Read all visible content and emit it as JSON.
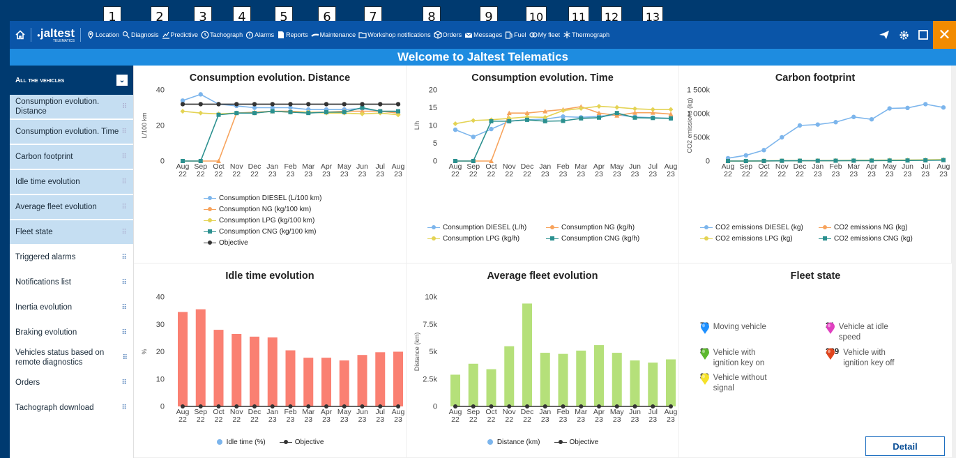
{
  "callouts": [
    "1",
    "2",
    "3",
    "4",
    "5",
    "6",
    "7",
    "8",
    "9",
    "10",
    "11",
    "12",
    "13"
  ],
  "brand": {
    "logo": "jaltest",
    "logo_sub": "TELEMATICS"
  },
  "nav": [
    {
      "label": "Location",
      "icon": "location-pin-icon"
    },
    {
      "label": "Diagnosis",
      "icon": "diagnosis-icon"
    },
    {
      "label": "Predictive",
      "icon": "predictive-icon"
    },
    {
      "label": "Tachograph",
      "icon": "tachograph-icon"
    },
    {
      "label": "Alarms",
      "icon": "alarm-icon"
    },
    {
      "label": "Reports",
      "icon": "reports-icon"
    },
    {
      "label": "Maintenance",
      "icon": "wrench-icon"
    },
    {
      "label": "Workshop notifications",
      "icon": "folder-icon"
    },
    {
      "label": "Orders",
      "icon": "box-icon"
    },
    {
      "label": "Messages",
      "icon": "envelope-icon"
    },
    {
      "label": "Fuel",
      "icon": "fuel-pump-icon"
    },
    {
      "label": "My fleet",
      "icon": "fleet-icon"
    },
    {
      "label": "Thermograph",
      "icon": "snowflake-icon"
    }
  ],
  "welcome": "Welcome to Jaltest Telematics",
  "sidebar": {
    "header": "All the vehicles",
    "items": [
      {
        "label": "Consumption evolution. Distance",
        "active": true
      },
      {
        "label": "Consumption evolution. Time",
        "active": true
      },
      {
        "label": "Carbon footprint",
        "active": true
      },
      {
        "label": "Idle time evolution",
        "active": true
      },
      {
        "label": "Average fleet evolution",
        "active": true
      },
      {
        "label": "Fleet state",
        "active": true
      },
      {
        "label": "Triggered alarms",
        "active": false
      },
      {
        "label": "Notifications list",
        "active": false
      },
      {
        "label": "Inertia evolution",
        "active": false
      },
      {
        "label": "Braking evolution",
        "active": false
      },
      {
        "label": "Vehicles status based on remote diagnostics",
        "active": false
      },
      {
        "label": "Orders",
        "active": false
      },
      {
        "label": "Tachograph download",
        "active": false
      }
    ]
  },
  "months": [
    [
      "Aug",
      "22"
    ],
    [
      "Sep",
      "22"
    ],
    [
      "Oct",
      "22"
    ],
    [
      "Nov",
      "22"
    ],
    [
      "Dec",
      "22"
    ],
    [
      "Jan",
      "23"
    ],
    [
      "Feb",
      "23"
    ],
    [
      "Mar",
      "23"
    ],
    [
      "Apr",
      "23"
    ],
    [
      "May",
      "23"
    ],
    [
      "Jun",
      "23"
    ],
    [
      "Jul",
      "23"
    ],
    [
      "Aug",
      "23"
    ]
  ],
  "chart_data": [
    {
      "id": "dist",
      "type": "line",
      "title": "Consumption evolution. Distance",
      "ylabel": "L/100 km",
      "ylim": [
        0,
        40
      ],
      "yticks": [
        "0",
        "20",
        "40"
      ],
      "ytickvals": [
        0,
        20,
        40
      ],
      "series": [
        {
          "name": "Consumption DIESEL (L/100 km)",
          "color": "#7cb5ec",
          "marker": "circle",
          "values": [
            34,
            37.5,
            32,
            31,
            30,
            30,
            30,
            29,
            29,
            29,
            29.5,
            28,
            27.5
          ]
        },
        {
          "name": "Consumption NG (kg/100 km)",
          "color": "#f7a35c",
          "marker": "triangle",
          "values": [
            0,
            0,
            0,
            27,
            27.5,
            28,
            28,
            27.5,
            27.5,
            28,
            28,
            28,
            27
          ]
        },
        {
          "name": "Consumption LPG (kg/100 km)",
          "color": "#e4d354",
          "marker": "diamond",
          "values": [
            28,
            27,
            26.5,
            27,
            27,
            28,
            27.5,
            27.5,
            27,
            27,
            26.5,
            27,
            26
          ]
        },
        {
          "name": "Consumption CNG (kg/100 km)",
          "color": "#2b908f",
          "marker": "square",
          "values": [
            0,
            0,
            26,
            27,
            27,
            28,
            27.5,
            27,
            27.5,
            27.5,
            30,
            28,
            28
          ]
        },
        {
          "name": "Objective",
          "color": "#333333",
          "marker": "circle",
          "values": [
            32,
            32,
            32,
            32,
            32,
            32,
            32,
            32,
            32,
            32,
            32,
            32,
            32
          ]
        }
      ]
    },
    {
      "id": "time",
      "type": "line",
      "title": "Consumption evolution. Time",
      "ylabel": "L/h",
      "ylim": [
        0,
        20
      ],
      "yticks": [
        "0",
        "5",
        "10",
        "15",
        "20"
      ],
      "ytickvals": [
        0,
        5,
        10,
        15,
        20
      ],
      "series": [
        {
          "name": "Consumption DIESEL (L/h)",
          "color": "#7cb5ec",
          "marker": "circle",
          "values": [
            8.8,
            6.8,
            9,
            11.2,
            11.6,
            11.8,
            12.5,
            12.3,
            12.6,
            13,
            12.4,
            12.2,
            12
          ]
        },
        {
          "name": "Consumption NG (kg/h)",
          "color": "#f7a35c",
          "marker": "triangle",
          "values": [
            0,
            0,
            0,
            13.5,
            13.5,
            14,
            14.5,
            15.3,
            13.5,
            12.8,
            13.6,
            13.6,
            13.2
          ]
        },
        {
          "name": "Consumption LPG (kg/h)",
          "color": "#e4d354",
          "marker": "diamond",
          "values": [
            10.5,
            11.4,
            11.6,
            12,
            12.4,
            12.3,
            14.2,
            14.8,
            15.4,
            15.1,
            14.7,
            14.5,
            14.5
          ]
        },
        {
          "name": "Consumption CNG (kg/h)",
          "color": "#2b908f",
          "marker": "square",
          "values": [
            0,
            0,
            11.2,
            11.2,
            11.6,
            11.2,
            11.3,
            12,
            12.2,
            13.5,
            12.2,
            12.1,
            12
          ]
        }
      ]
    },
    {
      "id": "carbon",
      "type": "line",
      "title": "Carbon footprint",
      "ylabel": "CO2 emissions (kg)",
      "ylim": [
        0,
        1500000
      ],
      "yticks": [
        "0",
        "500k",
        "1 000k",
        "1 500k"
      ],
      "ytickvals": [
        0,
        500000,
        1000000,
        1500000
      ],
      "series": [
        {
          "name": "CO2 emissions DIESEL (kg)",
          "color": "#7cb5ec",
          "marker": "circle",
          "values": [
            60000,
            120000,
            230000,
            500000,
            750000,
            770000,
            820000,
            930000,
            880000,
            1110000,
            1120000,
            1200000,
            1130000
          ]
        },
        {
          "name": "CO2 emissions NG (kg)",
          "color": "#f7a35c",
          "marker": "triangle",
          "values": [
            0,
            0,
            0,
            5000,
            5000,
            5000,
            8000,
            10000,
            12000,
            15000,
            18000,
            20000,
            25000
          ]
        },
        {
          "name": "CO2 emissions LPG (kg)",
          "color": "#e4d354",
          "marker": "diamond",
          "values": [
            0,
            0,
            5000,
            8000,
            10000,
            10000,
            12000,
            15000,
            18000,
            20000,
            22000,
            25000,
            30000
          ]
        },
        {
          "name": "CO2 emissions CNG (kg)",
          "color": "#2b908f",
          "marker": "square",
          "values": [
            0,
            0,
            2000,
            5000,
            6000,
            6000,
            7000,
            8000,
            9000,
            10000,
            12000,
            15000,
            20000
          ]
        }
      ]
    },
    {
      "id": "idle",
      "type": "bar",
      "title": "Idle time evolution",
      "ylabel": "%",
      "ylim": [
        0,
        40
      ],
      "yticks": [
        "0",
        "10",
        "20",
        "30",
        "40"
      ],
      "ytickvals": [
        0,
        10,
        20,
        30,
        40
      ],
      "series": [
        {
          "name": "Idle time (%)",
          "color": "#fa8072",
          "legendColor": "#7cb5ec",
          "values": [
            34.5,
            35.5,
            28,
            26.5,
            25.5,
            25.2,
            20.5,
            17.8,
            17.8,
            16.8,
            18.8,
            19.8,
            20
          ]
        },
        {
          "name": "Objective",
          "color": "#333333",
          "values": [
            0,
            0,
            0,
            0,
            0,
            0,
            0,
            0,
            0,
            0,
            0,
            0,
            0
          ]
        }
      ]
    },
    {
      "id": "avg",
      "type": "bar",
      "title": "Average fleet evolution",
      "ylabel": "Distance (km)",
      "ylim": [
        0,
        10000
      ],
      "yticks": [
        "0",
        "2.5k",
        "5k",
        "7.5k",
        "10k"
      ],
      "ytickvals": [
        0,
        2500,
        5000,
        7500,
        10000
      ],
      "series": [
        {
          "name": "Distance (km)",
          "color": "#b5e07a",
          "legendColor": "#7cb5ec",
          "values": [
            2900,
            3900,
            3400,
            5500,
            9400,
            4900,
            4800,
            5100,
            5600,
            4900,
            4200,
            4000,
            4300
          ]
        },
        {
          "name": "Objective",
          "color": "#333333",
          "values": [
            0,
            0,
            0,
            0,
            0,
            0,
            0,
            0,
            0,
            0,
            0,
            0,
            0
          ]
        }
      ]
    }
  ],
  "fleet_state": {
    "title": "Fleet state",
    "items": [
      {
        "count": "79",
        "label": "Moving vehicle",
        "color": "#1e90ff"
      },
      {
        "count": "31",
        "label": "Vehicle at idle speed",
        "color": "#e040c0"
      },
      {
        "count": "80",
        "label": "Vehicle with ignition key on",
        "color": "#5cb82e"
      },
      {
        "count": "389",
        "label": "Vehicle with ignition key off",
        "color": "#e0441c"
      },
      {
        "count": "89",
        "label": "Vehicle without signal",
        "color": "#f5e12a"
      }
    ],
    "detail_label": "Detail"
  }
}
